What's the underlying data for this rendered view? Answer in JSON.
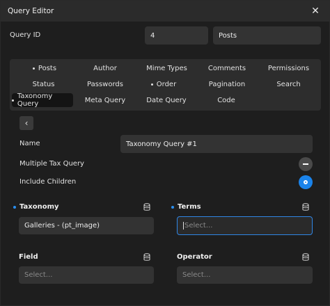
{
  "window": {
    "title": "Query Editor"
  },
  "query_id": {
    "label": "Query ID",
    "id_value": "4",
    "type_value": "Posts"
  },
  "tabs": [
    {
      "label": "Posts",
      "dot": true
    },
    {
      "label": "Author",
      "dot": false
    },
    {
      "label": "Mime Types",
      "dot": false
    },
    {
      "label": "Comments",
      "dot": false
    },
    {
      "label": "Permissions",
      "dot": false
    },
    {
      "label": "Status",
      "dot": false
    },
    {
      "label": "Passwords",
      "dot": false
    },
    {
      "label": "Order",
      "dot": true
    },
    {
      "label": "Pagination",
      "dot": false
    },
    {
      "label": "Search",
      "dot": false
    },
    {
      "label": "Taxonomy Query",
      "dot": true,
      "active": true
    },
    {
      "label": "Meta Query",
      "dot": false
    },
    {
      "label": "Date Query",
      "dot": false
    },
    {
      "label": "Code",
      "dot": false
    }
  ],
  "form": {
    "name_label": "Name",
    "name_value": "Taxonomy Query #1",
    "multiple_label": "Multiple Tax Query",
    "children_label": "Include Children",
    "taxonomy_label": "Taxonomy",
    "taxonomy_value": "Galleries - (pt_image)",
    "terms_label": "Terms",
    "terms_placeholder": "Select...",
    "field_label": "Field",
    "field_placeholder": "Select...",
    "operator_label": "Operator",
    "operator_placeholder": "Select..."
  },
  "colors": {
    "accent": "#1a83ea",
    "background": "#1e1e1e",
    "input": "#333333"
  }
}
